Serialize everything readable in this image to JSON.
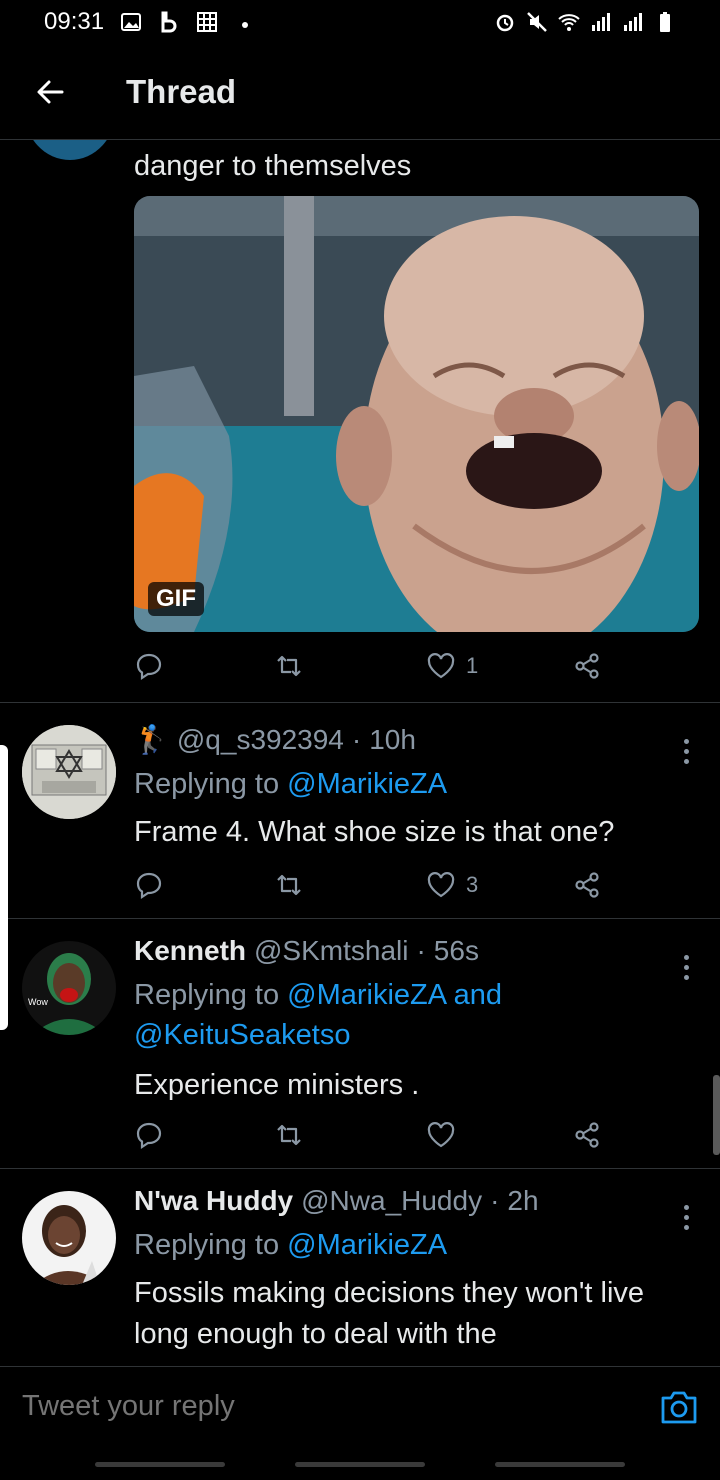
{
  "status_bar": {
    "time": "09:31"
  },
  "header": {
    "title": "Thread"
  },
  "previous_tweet": {
    "text_tail": "danger to themselves",
    "gif_label": "GIF",
    "likes": "1"
  },
  "tweets": [
    {
      "emoji": "🏌",
      "handle": "@q_s392394",
      "sep": "·",
      "time": "10h",
      "replying_prefix": "Replying to",
      "mentions": "@MarikieZA",
      "text": "Frame 4. What shoe size is that one?",
      "likes": "3"
    },
    {
      "name": "Kenneth",
      "handle": "@SKmtshali",
      "sep": "·",
      "time": "56s",
      "replying_prefix": "Replying to",
      "mentions": "@MarikieZA and @KeituSeaketso",
      "text": "Experience ministers .",
      "avatar_badge": "Wow"
    },
    {
      "name": "N'wa Huddy",
      "handle": "@Nwa_Huddy",
      "sep": "·",
      "time": "2h",
      "replying_prefix": "Replying to",
      "mentions": "@MarikieZA",
      "text": "Fossils making decisions they won't live long enough to deal with the"
    }
  ],
  "composer": {
    "placeholder": "Tweet your reply"
  },
  "colors": {
    "accent": "#1d9bf0",
    "muted": "#8b98a5",
    "text": "#e7e9ea",
    "divider": "#2f3336"
  }
}
